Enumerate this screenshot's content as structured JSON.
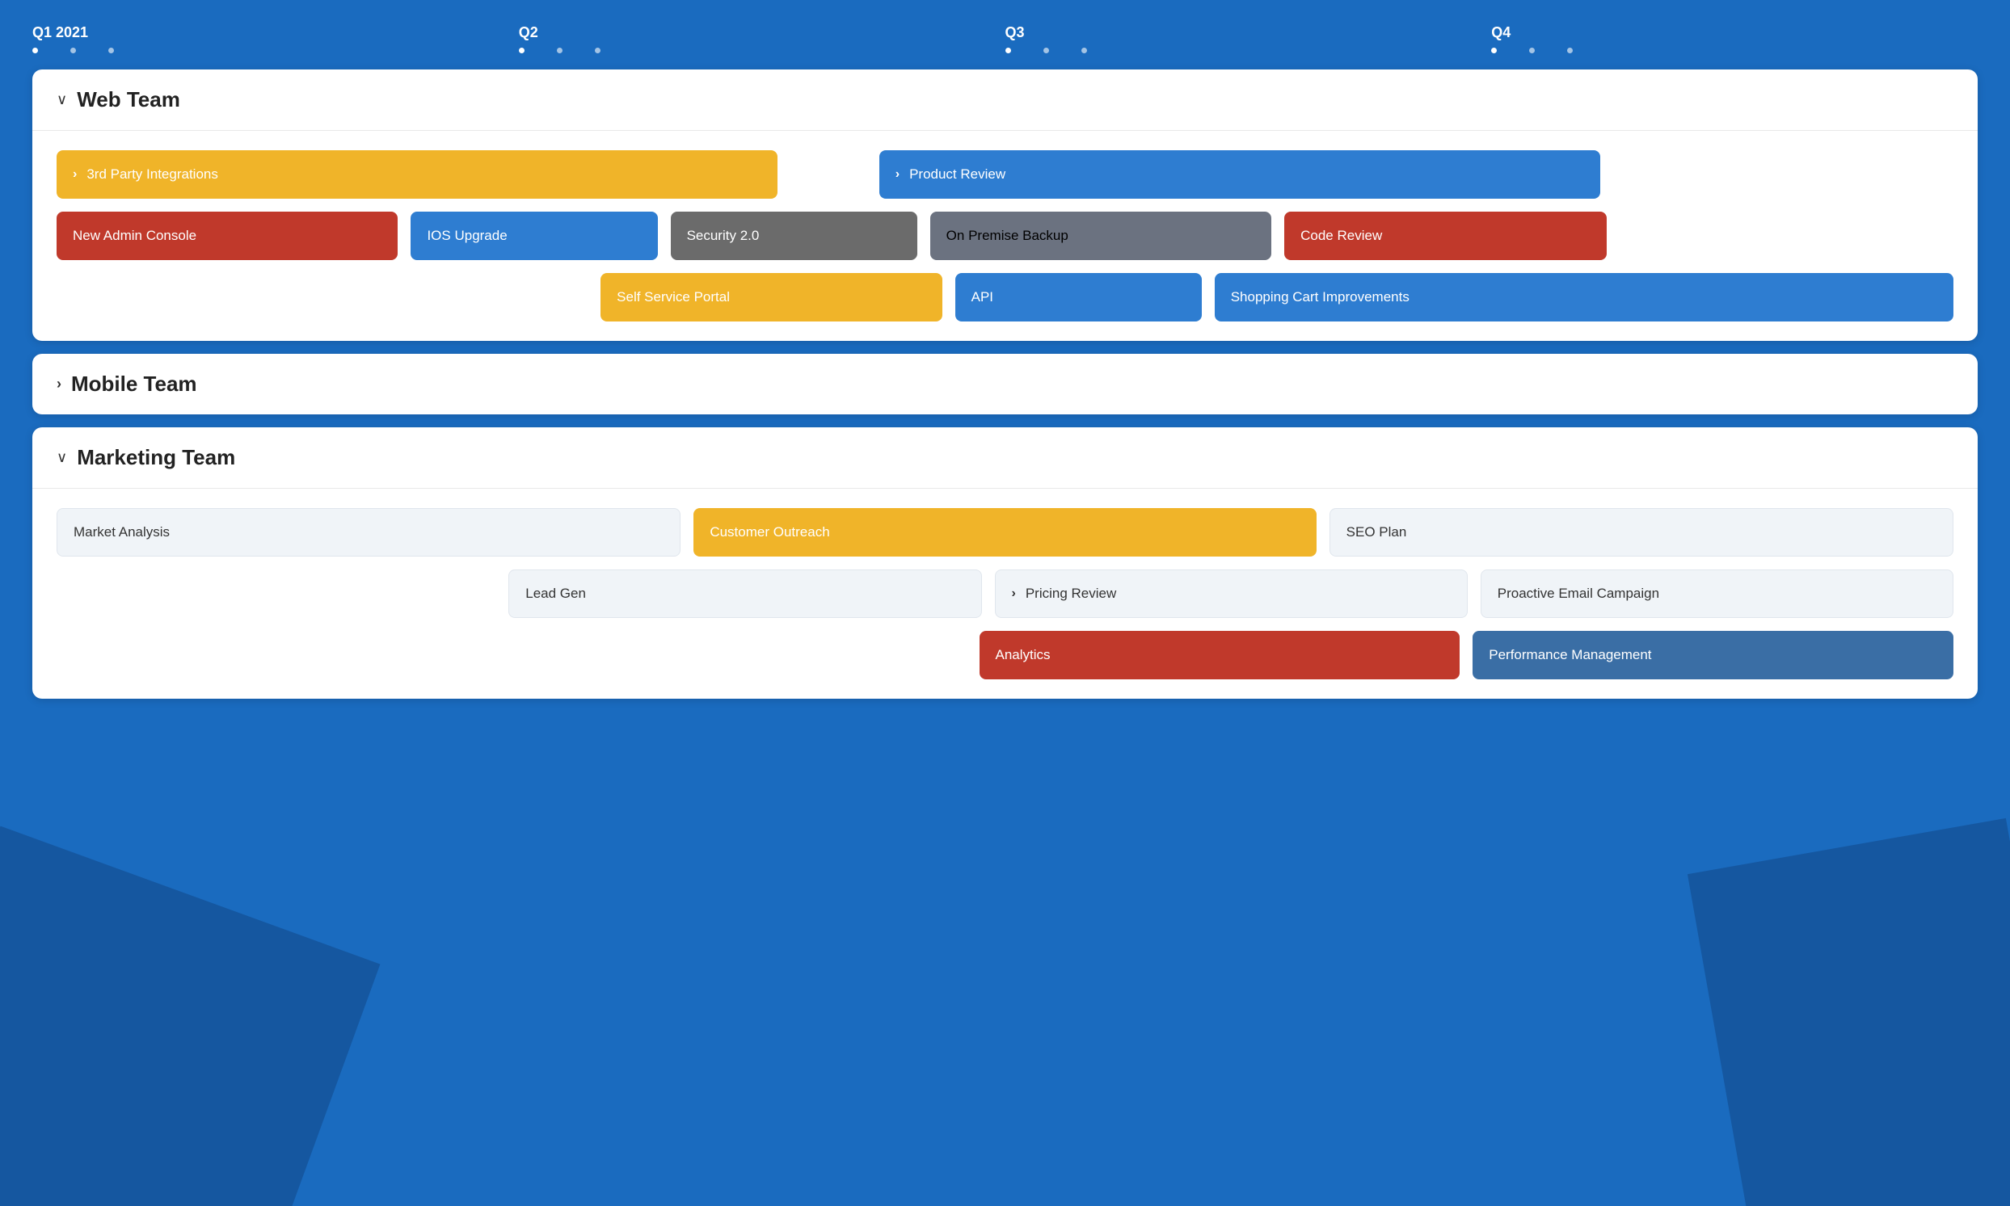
{
  "timeline": {
    "quarters": [
      {
        "label": "Q1 2021",
        "dots": 3
      },
      {
        "label": "Q2",
        "dots": 3
      },
      {
        "label": "Q3",
        "dots": 3
      },
      {
        "label": "Q4",
        "dots": 3
      }
    ]
  },
  "sections": {
    "web_team": {
      "title": "Web Team",
      "expanded": true,
      "toggle_open": "∨",
      "toggle_closed": ">",
      "rows": {
        "row1": {
          "left": {
            "label": "3rd Party Integrations",
            "color": "yellow",
            "has_chevron": true
          },
          "right": {
            "label": "Product Review",
            "color": "blue",
            "has_chevron": true
          }
        },
        "row2": {
          "items": [
            {
              "label": "New Admin Console",
              "color": "red"
            },
            {
              "label": "IOS Upgrade",
              "color": "blue"
            },
            {
              "label": "Security 2.0",
              "color": "gray"
            },
            {
              "label": "On Premise Backup",
              "color": "gray_dark"
            },
            {
              "label": "Code Review",
              "color": "red"
            }
          ]
        },
        "row3": {
          "items": [
            {
              "label": "Self Service Portal",
              "color": "yellow"
            },
            {
              "label": "API",
              "color": "blue"
            },
            {
              "label": "Shopping Cart Improvements",
              "color": "blue"
            }
          ]
        }
      }
    },
    "mobile_team": {
      "title": "Mobile Team",
      "expanded": false,
      "toggle_open": "∨",
      "toggle_closed": ">"
    },
    "marketing_team": {
      "title": "Marketing Team",
      "expanded": true,
      "toggle_open": "∨",
      "toggle_closed": ">",
      "rows": {
        "row1": {
          "items": [
            {
              "label": "Market Analysis",
              "color": "light"
            },
            {
              "label": "Customer Outreach",
              "color": "yellow"
            },
            {
              "label": "SEO Plan",
              "color": "light"
            }
          ]
        },
        "row2": {
          "items": [
            {
              "label": "Lead Gen",
              "color": "light"
            },
            {
              "label": "Pricing Review",
              "color": "light",
              "has_chevron": true
            },
            {
              "label": "Proactive Email Campaign",
              "color": "light"
            }
          ]
        },
        "row3": {
          "items": [
            {
              "label": "Analytics",
              "color": "red"
            },
            {
              "label": "Performance Management",
              "color": "blue_medium"
            }
          ]
        }
      }
    }
  }
}
